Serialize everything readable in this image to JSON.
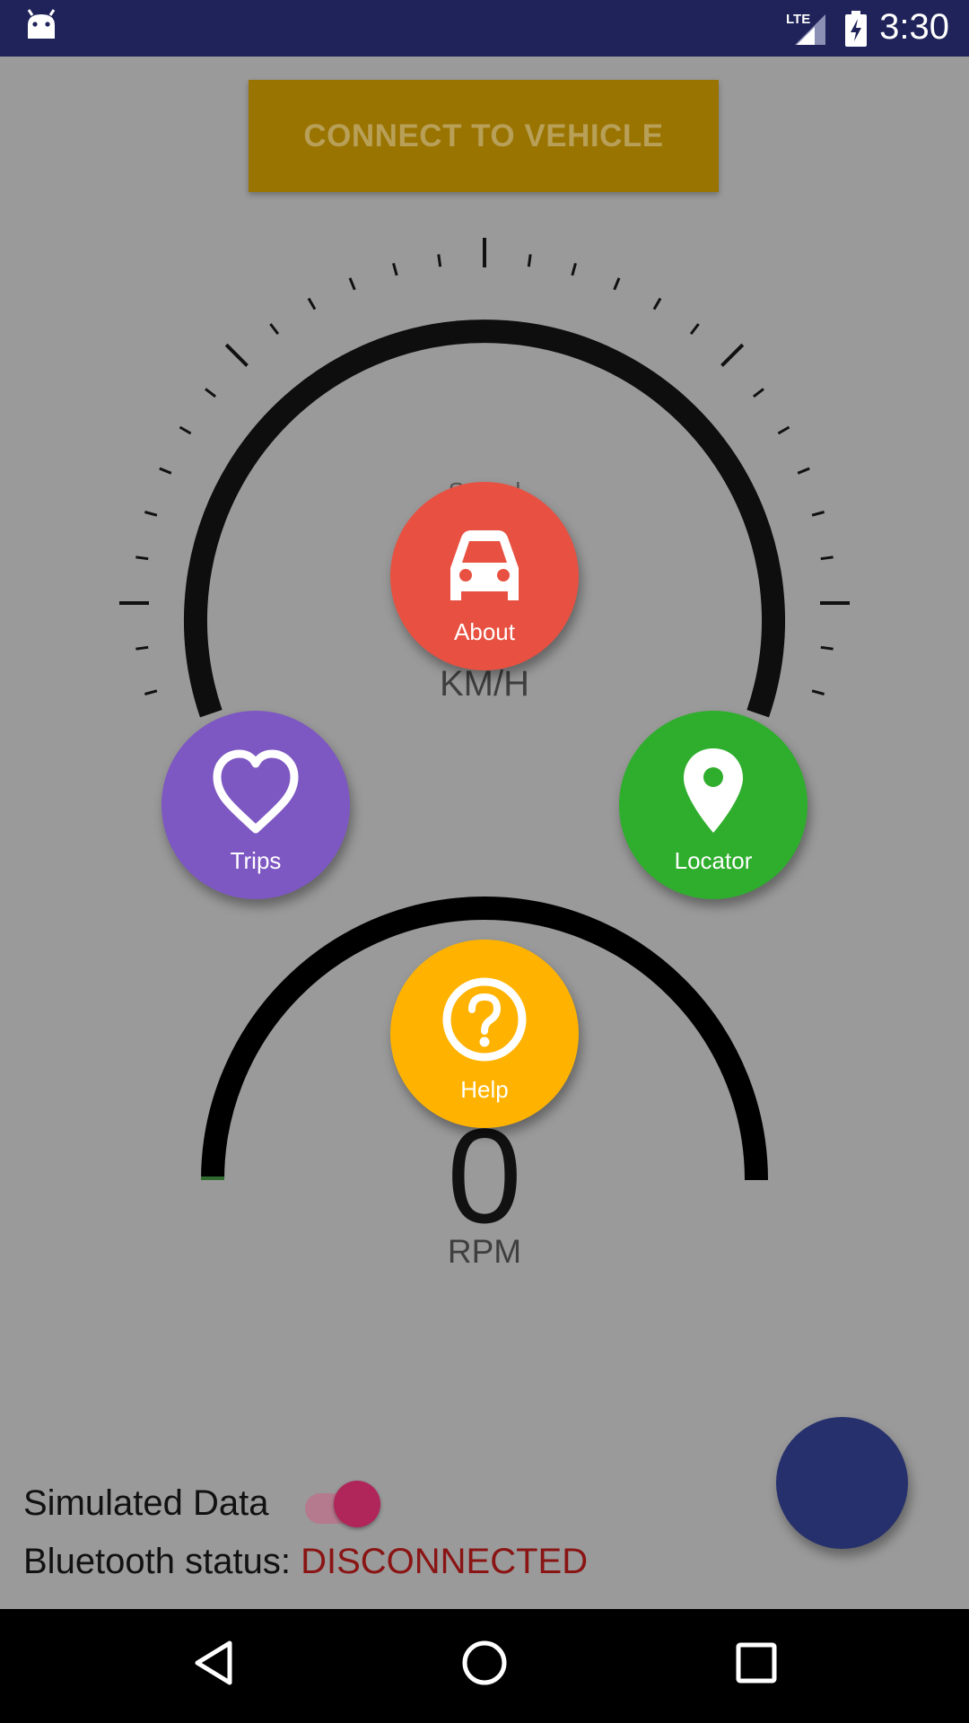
{
  "status_bar": {
    "time": "3:30",
    "network": "LTE",
    "icons": [
      "android-icon",
      "lte-signal-icon",
      "battery-charging-icon"
    ]
  },
  "connect_button": {
    "label": "CONNECT TO VEHICLE"
  },
  "speed_gauge": {
    "title": "Speed",
    "unit": "KM/H"
  },
  "rpm_gauge": {
    "value": "0",
    "unit": "RPM"
  },
  "menu": {
    "about": {
      "label": "About",
      "icon": "car-icon",
      "color": "#e85142"
    },
    "trips": {
      "label": "Trips",
      "icon": "heart-icon",
      "color": "#7e58c2"
    },
    "locator": {
      "label": "Locator",
      "icon": "location-pin-icon",
      "color": "#2fae2d"
    },
    "help": {
      "label": "Help",
      "icon": "help-circle-icon",
      "color": "#ffb300"
    }
  },
  "fab": {
    "color": "#26306d"
  },
  "simulated_data": {
    "label": "Simulated Data",
    "enabled": true
  },
  "bluetooth": {
    "label": "Bluetooth status: ",
    "value": "DISCONNECTED",
    "value_color": "#8a1414"
  },
  "nav_bar": {
    "items": [
      "back-icon",
      "home-icon",
      "recents-icon"
    ]
  }
}
